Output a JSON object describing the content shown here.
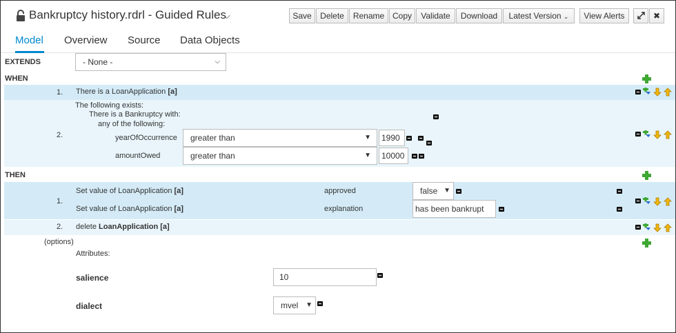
{
  "header": {
    "title": "Bankruptcy history.rdrl - Guided Rules",
    "buttons": {
      "save": "Save",
      "delete": "Delete",
      "rename": "Rename",
      "copy": "Copy",
      "validate": "Validate",
      "download": "Download",
      "latest_version": "Latest Version",
      "view_alerts": "View Alerts"
    }
  },
  "tabs": [
    "Model",
    "Overview",
    "Source",
    "Data Objects"
  ],
  "extends": {
    "label": "EXTENDS",
    "value": "- None -"
  },
  "when": {
    "label": "WHEN",
    "rows": [
      {
        "num": "1.",
        "text": "There is a LoanApplication",
        "bold": "[a]"
      },
      {
        "num": "2.",
        "line1": "The following exists:",
        "line2": "There is a Bankruptcy with:",
        "line3": "any of the following:",
        "fields": [
          {
            "name": "yearOfOccurrence",
            "operator": "greater than",
            "value": "1990"
          },
          {
            "name": "amountOwed",
            "operator": "greater than",
            "value": "10000"
          }
        ]
      }
    ]
  },
  "then": {
    "label": "THEN",
    "rows": [
      {
        "num": "1.",
        "actions": [
          {
            "text": "Set value of LoanApplication",
            "bold": "[a]",
            "field": "approved",
            "value": "false"
          },
          {
            "text": "Set value of LoanApplication",
            "bold": "[a]",
            "field": "explanation",
            "value": "has been bankrupt"
          }
        ]
      },
      {
        "num": "2.",
        "text": "delete",
        "bold": "LoanApplication [a]"
      }
    ]
  },
  "options": {
    "label": "(options)",
    "attributes_label": "Attributes:",
    "salience": {
      "label": "salience",
      "value": "10"
    },
    "dialect": {
      "label": "dialect",
      "value": "mvel"
    }
  }
}
